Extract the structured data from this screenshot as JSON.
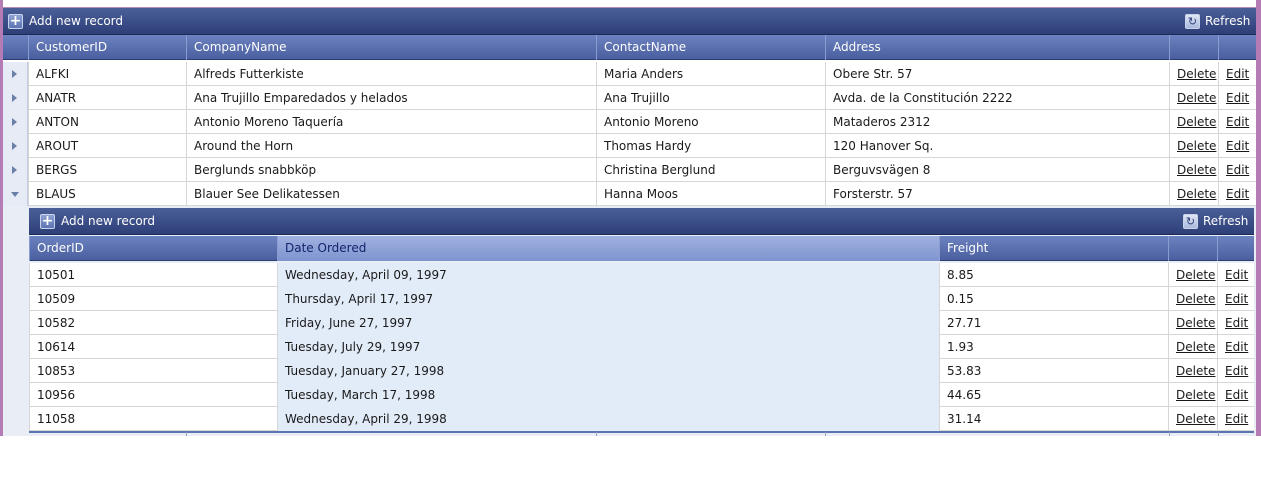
{
  "master": {
    "toolbar": {
      "add_label": "Add new record",
      "refresh_label": "Refresh"
    },
    "columns": [
      "CustomerID",
      "CompanyName",
      "ContactName",
      "Address"
    ],
    "delete_label": "Delete",
    "edit_label": "Edit",
    "rows": [
      {
        "id": "ALFKI",
        "company": "Alfreds Futterkiste",
        "contact": "Maria Anders",
        "address": "Obere Str. 57",
        "expanded": false
      },
      {
        "id": "ANATR",
        "company": "Ana Trujillo Emparedados y helados",
        "contact": "Ana Trujillo",
        "address": "Avda. de la Constitución 2222",
        "expanded": false
      },
      {
        "id": "ANTON",
        "company": "Antonio Moreno Taquería",
        "contact": "Antonio Moreno",
        "address": "Mataderos 2312",
        "expanded": false
      },
      {
        "id": "AROUT",
        "company": "Around the Horn",
        "contact": "Thomas Hardy",
        "address": "120 Hanover Sq.",
        "expanded": false
      },
      {
        "id": "BERGS",
        "company": "Berglunds snabbköp",
        "contact": "Christina Berglund",
        "address": "Berguvsvägen 8",
        "expanded": false
      },
      {
        "id": "BLAUS",
        "company": "Blauer See Delikatessen",
        "contact": "Hanna Moos",
        "address": "Forsterstr. 57",
        "expanded": true
      }
    ]
  },
  "detail": {
    "toolbar": {
      "add_label": "Add new record",
      "refresh_label": "Refresh"
    },
    "columns": [
      "OrderID",
      "Date Ordered",
      "Freight"
    ],
    "sorted_column": "Date Ordered",
    "delete_label": "Delete",
    "edit_label": "Edit",
    "rows": [
      {
        "order_id": "10501",
        "date": "Wednesday, April 09, 1997",
        "freight": "8.85"
      },
      {
        "order_id": "10509",
        "date": "Thursday, April 17, 1997",
        "freight": "0.15"
      },
      {
        "order_id": "10582",
        "date": "Friday, June 27, 1997",
        "freight": "27.71"
      },
      {
        "order_id": "10614",
        "date": "Tuesday, July 29, 1997",
        "freight": "1.93"
      },
      {
        "order_id": "10853",
        "date": "Tuesday, January 27, 1998",
        "freight": "53.83"
      },
      {
        "order_id": "10956",
        "date": "Tuesday, March 17, 1998",
        "freight": "44.65"
      },
      {
        "order_id": "11058",
        "date": "Wednesday, April 29, 1998",
        "freight": "31.14"
      }
    ]
  },
  "icons": {
    "add": "plus-icon",
    "refresh": "refresh-icon",
    "collapsed": "expand-arrow-icon",
    "expanded": "collapse-arrow-icon"
  },
  "colors": {
    "toolbar": "#2e3f78",
    "header": "#5a6fb0",
    "sorted_column": "#e2ecf8",
    "frame": "#b57bb4"
  }
}
